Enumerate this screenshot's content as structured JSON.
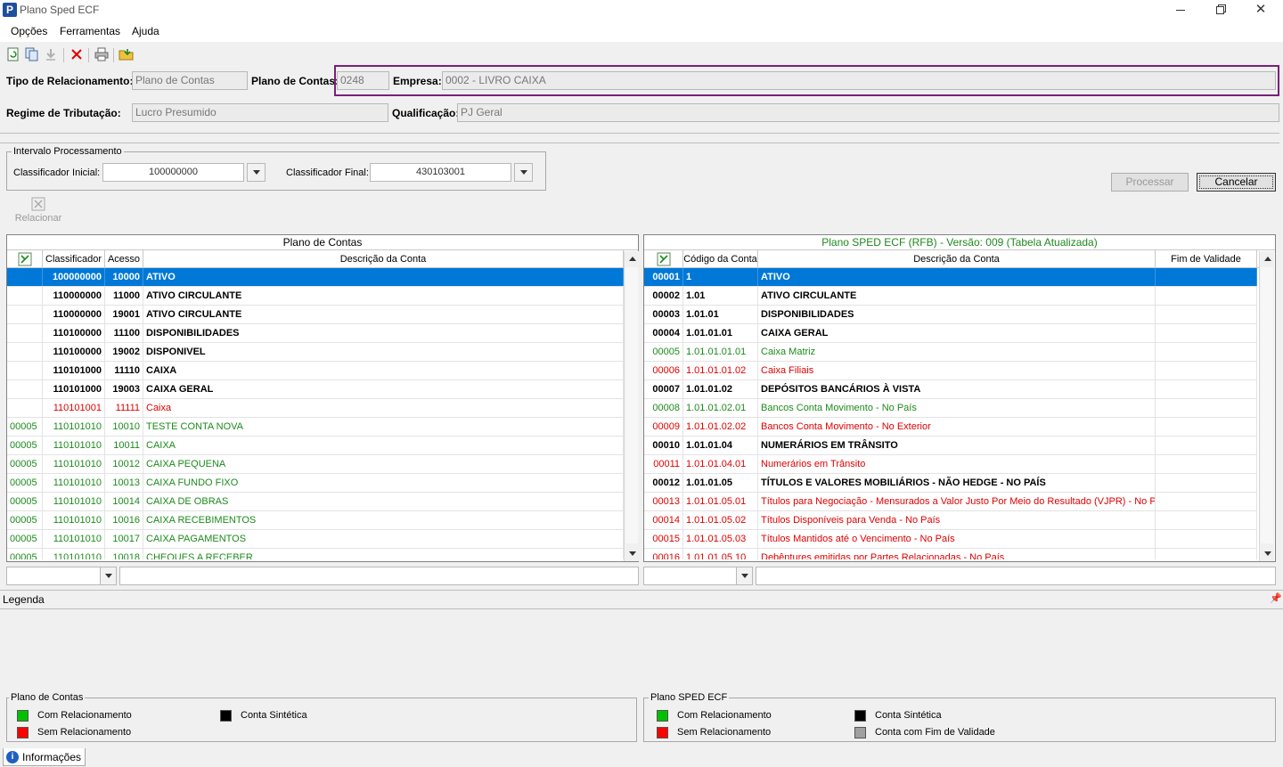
{
  "window": {
    "title": "Plano Sped ECF",
    "icon": "P"
  },
  "menu": [
    "Opções",
    "Ferramentas",
    "Ajuda"
  ],
  "header": {
    "tipo_label": "Tipo de Relacionamento:",
    "tipo_value": "Plano de Contas",
    "plano_label": "Plano de Contas:",
    "plano_value": "0248",
    "empresa_label": "Empresa:",
    "empresa_value": "0002 - LIVRO CAIXA",
    "regime_label": "Regime de Tributação:",
    "regime_value": "Lucro Presumido",
    "qualif_label": "Qualificação:",
    "qualif_value": "PJ Geral"
  },
  "intervalo": {
    "title": "Intervalo Processamento",
    "inicial_label": "Classificador Inicial:",
    "inicial_value": "100000000",
    "final_label": "Classificador Final:",
    "final_value": "430103001"
  },
  "buttons": {
    "processar": "Processar",
    "cancelar": "Cancelar",
    "relacionar": "Relacionar"
  },
  "left_grid": {
    "title": "Plano de Contas",
    "columns": [
      "Classificador",
      "Acesso",
      "Descrição da Conta"
    ],
    "rows": [
      {
        "rel": "",
        "class": "100000000",
        "acesso": "10000",
        "desc": "ATIVO",
        "style": "sel"
      },
      {
        "rel": "",
        "class": "110000000",
        "acesso": "11000",
        "desc": "ATIVO CIRCULANTE",
        "style": "bold"
      },
      {
        "rel": "",
        "class": "110000000",
        "acesso": "19001",
        "desc": "ATIVO CIRCULANTE",
        "style": "bold"
      },
      {
        "rel": "",
        "class": "110100000",
        "acesso": "11100",
        "desc": "DISPONIBILIDADES",
        "style": "bold"
      },
      {
        "rel": "",
        "class": "110100000",
        "acesso": "19002",
        "desc": "DISPONIVEL",
        "style": "bold"
      },
      {
        "rel": "",
        "class": "110101000",
        "acesso": "11110",
        "desc": "CAIXA",
        "style": "bold"
      },
      {
        "rel": "",
        "class": "110101000",
        "acesso": "19003",
        "desc": "CAIXA GERAL",
        "style": "bold"
      },
      {
        "rel": "",
        "class": "110101001",
        "acesso": "11111",
        "desc": "Caixa",
        "style": "red"
      },
      {
        "rel": "00005",
        "class": "110101010",
        "acesso": "10010",
        "desc": "TESTE CONTA NOVA",
        "style": "green"
      },
      {
        "rel": "00005",
        "class": "110101010",
        "acesso": "10011",
        "desc": "CAIXA",
        "style": "green"
      },
      {
        "rel": "00005",
        "class": "110101010",
        "acesso": "10012",
        "desc": "CAIXA PEQUENA",
        "style": "green"
      },
      {
        "rel": "00005",
        "class": "110101010",
        "acesso": "10013",
        "desc": "CAIXA FUNDO FIXO",
        "style": "green"
      },
      {
        "rel": "00005",
        "class": "110101010",
        "acesso": "10014",
        "desc": "CAIXA DE OBRAS",
        "style": "green"
      },
      {
        "rel": "00005",
        "class": "110101010",
        "acesso": "10016",
        "desc": "CAIXA RECEBIMENTOS",
        "style": "green"
      },
      {
        "rel": "00005",
        "class": "110101010",
        "acesso": "10017",
        "desc": "CAIXA PAGAMENTOS",
        "style": "green"
      },
      {
        "rel": "00005",
        "class": "110101010",
        "acesso": "10018",
        "desc": "CHEQUES A RECEBER",
        "style": "green"
      }
    ]
  },
  "right_grid": {
    "title": "Plano SPED ECF (RFB) - Versão: 009 (Tabela Atualizada)",
    "columns": [
      "Código da Conta",
      "Descrição da Conta",
      "Fim de Validade"
    ],
    "rows": [
      {
        "id": "00001",
        "cod": "1",
        "desc": "ATIVO",
        "fim": "",
        "style": "sel"
      },
      {
        "id": "00002",
        "cod": "1.01",
        "desc": "ATIVO CIRCULANTE",
        "fim": "",
        "style": "bold"
      },
      {
        "id": "00003",
        "cod": "1.01.01",
        "desc": "DISPONIBILIDADES",
        "fim": "",
        "style": "bold"
      },
      {
        "id": "00004",
        "cod": "1.01.01.01",
        "desc": "CAIXA GERAL",
        "fim": "",
        "style": "bold"
      },
      {
        "id": "00005",
        "cod": "1.01.01.01.01",
        "desc": "Caixa Matriz",
        "fim": "",
        "style": "green"
      },
      {
        "id": "00006",
        "cod": "1.01.01.01.02",
        "desc": "Caixa Filiais",
        "fim": "",
        "style": "red"
      },
      {
        "id": "00007",
        "cod": "1.01.01.02",
        "desc": "DEPÓSITOS BANCÁRIOS À VISTA",
        "fim": "",
        "style": "bold"
      },
      {
        "id": "00008",
        "cod": "1.01.01.02.01",
        "desc": "Bancos Conta Movimento - No País",
        "fim": "",
        "style": "green"
      },
      {
        "id": "00009",
        "cod": "1.01.01.02.02",
        "desc": "Bancos Conta Movimento - No Exterior",
        "fim": "",
        "style": "red"
      },
      {
        "id": "00010",
        "cod": "1.01.01.04",
        "desc": "NUMERÁRIOS EM TRÂNSITO",
        "fim": "",
        "style": "bold"
      },
      {
        "id": "00011",
        "cod": "1.01.01.04.01",
        "desc": "Numerários em Trânsito",
        "fim": "",
        "style": "red"
      },
      {
        "id": "00012",
        "cod": "1.01.01.05",
        "desc": "TÍTULOS E VALORES MOBILIÁRIOS - NÃO HEDGE - NO PAÍS",
        "fim": "",
        "style": "bold"
      },
      {
        "id": "00013",
        "cod": "1.01.01.05.01",
        "desc": "Títulos para Negociação - Mensurados a Valor Justo Por Meio do Resultado (VJPR) - No País",
        "fim": "",
        "style": "red"
      },
      {
        "id": "00014",
        "cod": "1.01.01.05.02",
        "desc": "Títulos Disponíveis para Venda - No País",
        "fim": "",
        "style": "red"
      },
      {
        "id": "00015",
        "cod": "1.01.01.05.03",
        "desc": "Títulos Mantidos até o Vencimento - No País",
        "fim": "",
        "style": "red"
      },
      {
        "id": "00016",
        "cod": "1.01.01.05.10",
        "desc": "Debêntures emitidas por Partes Relacionadas - No País",
        "fim": "",
        "style": "red"
      }
    ]
  },
  "legenda": {
    "title": "Legenda",
    "left_title": "Plano de Contas",
    "right_title": "Plano SPED ECF",
    "com_rel": "Com Relacionamento",
    "sem_rel": "Sem Relacionamento",
    "sintetica": "Conta Sintética",
    "fim_validade": "Conta com Fim de Validade"
  },
  "colors": {
    "green": "#00c000",
    "red": "#ff0000",
    "black": "#000000",
    "gray": "#a0a0a0",
    "selection": "#0078d7",
    "highlight_border": "#7a1f7a"
  },
  "statusbar": {
    "informacoes": "Informações"
  }
}
